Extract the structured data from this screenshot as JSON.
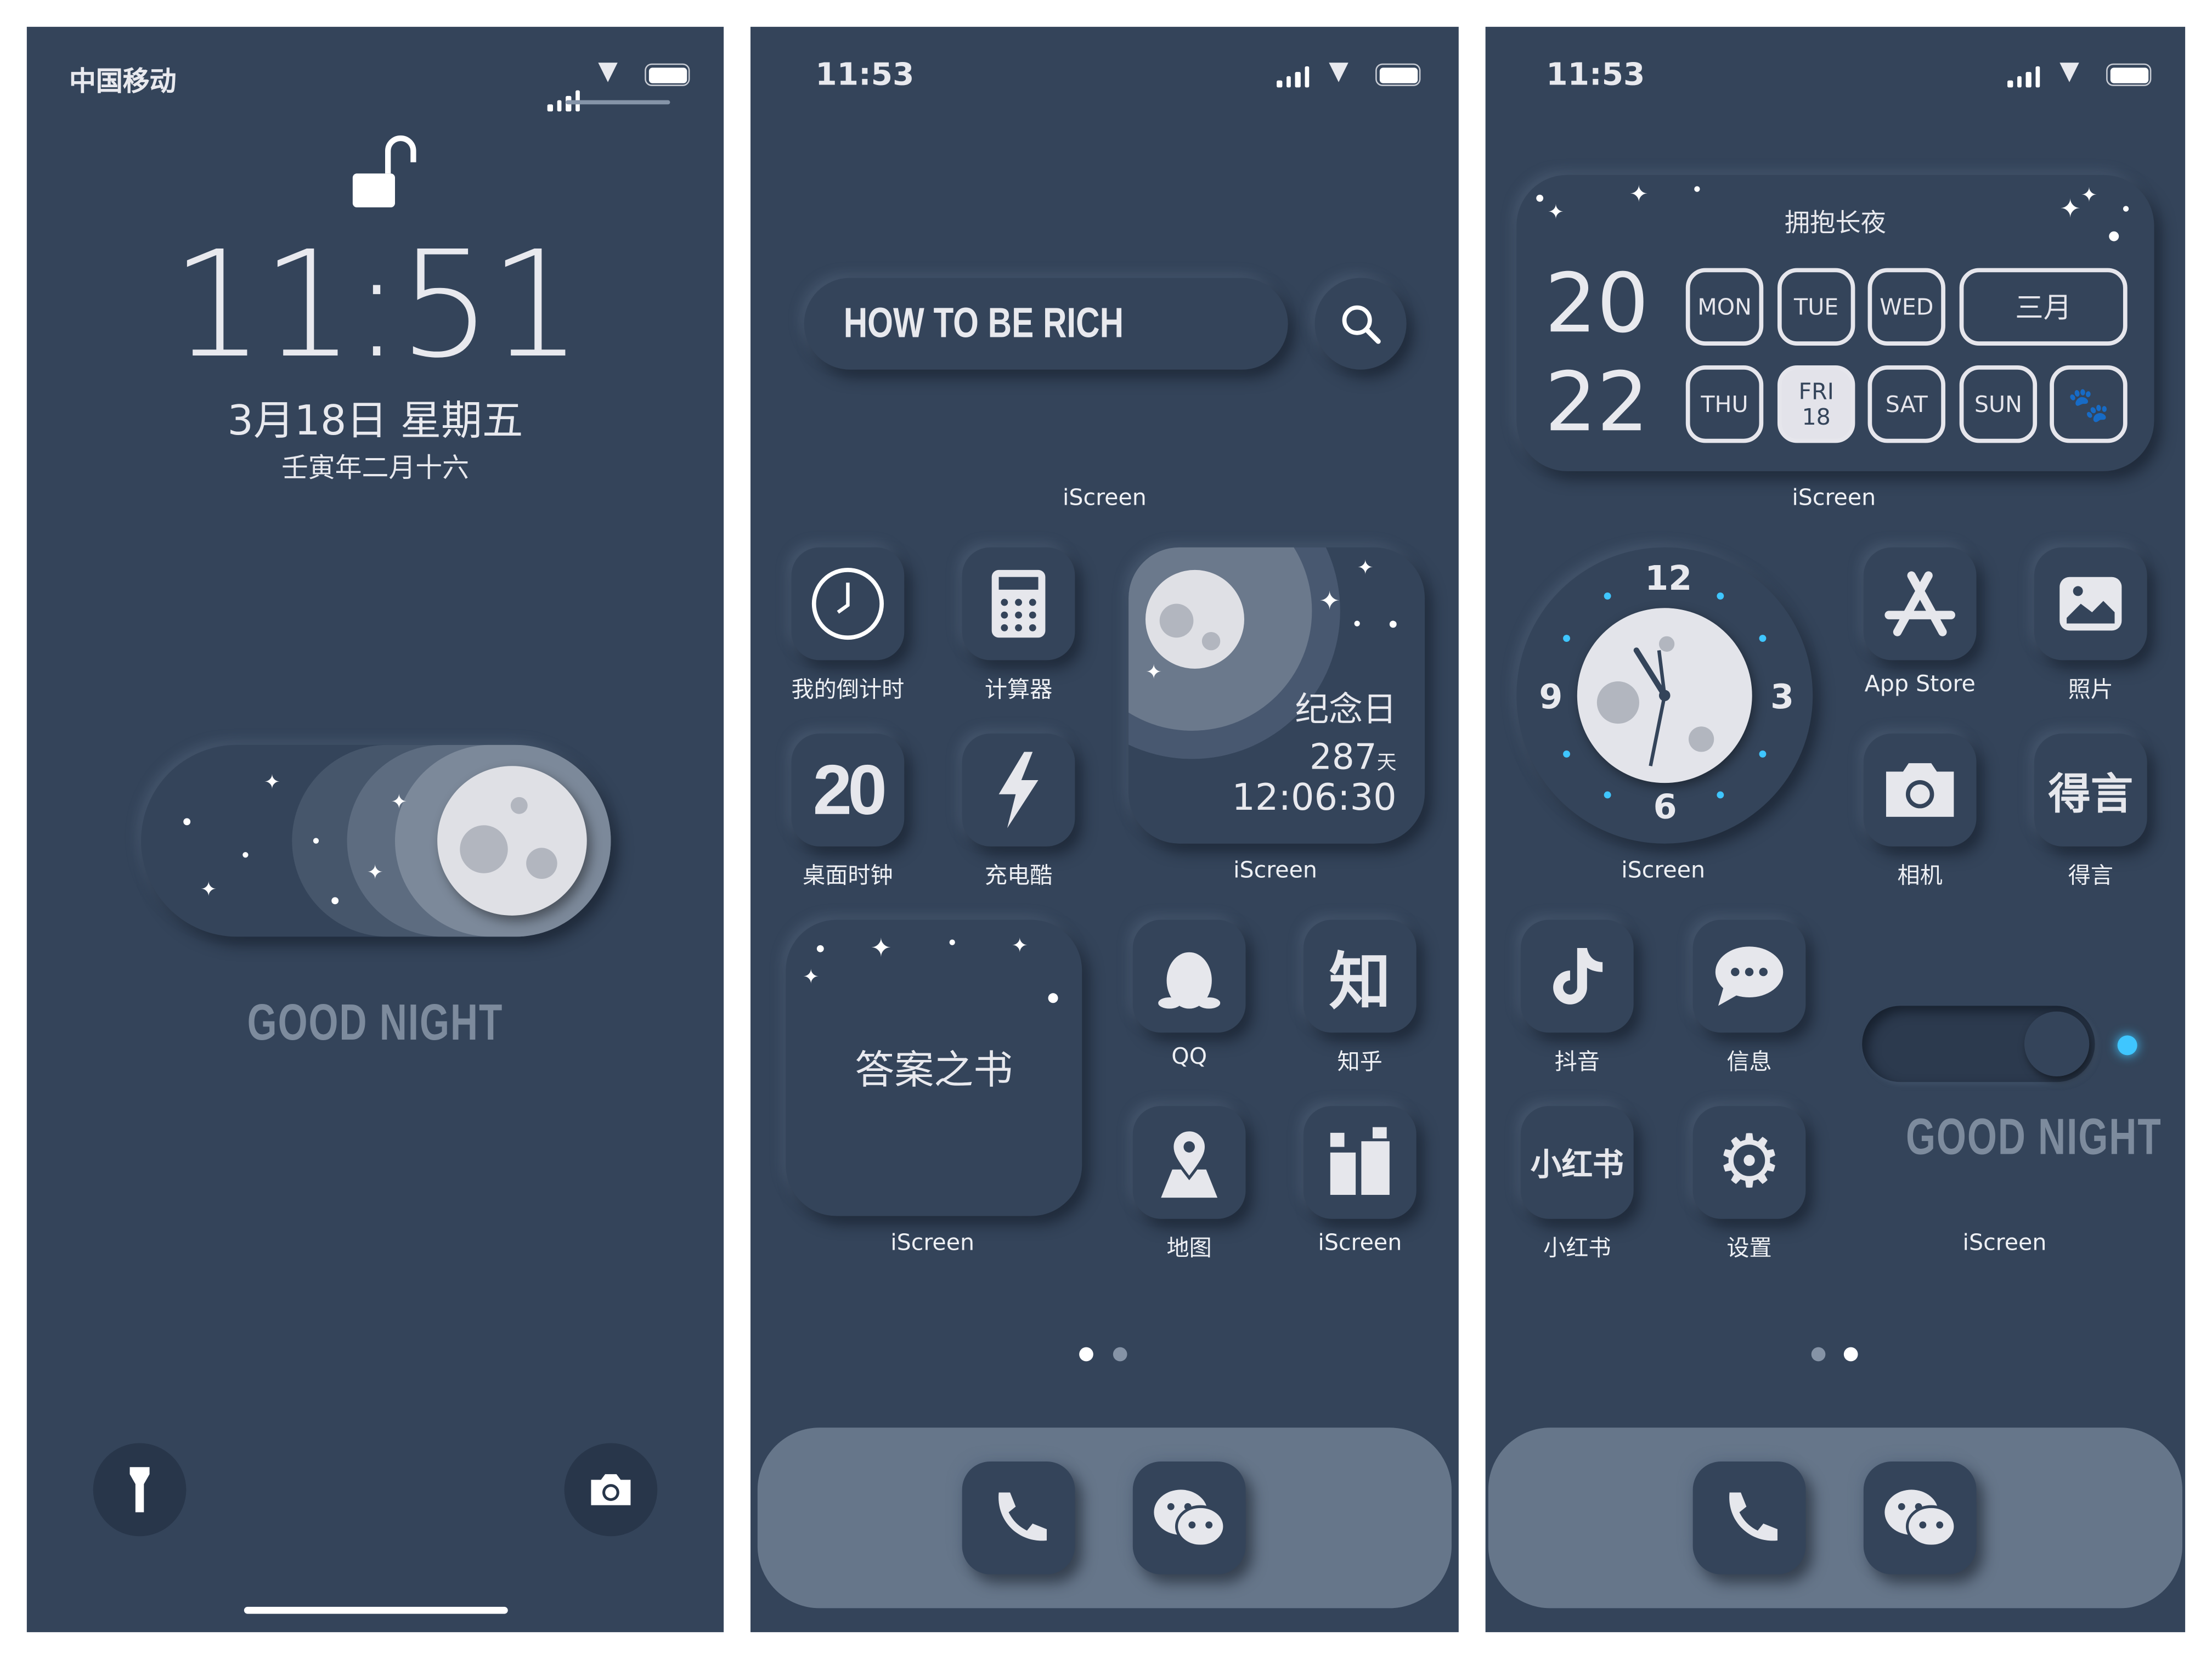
{
  "colors": {
    "background": "#34445a",
    "dock": "#66768a",
    "text": "#e8e9ee",
    "accent_blue": "#3fc6ff",
    "muted": "#7d8b9d"
  },
  "lock_screen": {
    "carrier": "中国移动",
    "time": "11:51",
    "date": "3月18日 星期五",
    "lunar": "壬寅年二月十六",
    "good_night": "GOOD NIGHT",
    "icons": [
      "signal-icon",
      "wifi-icon",
      "battery-icon",
      "unlock-icon",
      "flashlight-icon",
      "camera-icon"
    ]
  },
  "home1": {
    "time": "11:53",
    "search_text": "HOW TO BE RICH",
    "search_widget_label": "iScreen",
    "apps": [
      {
        "label": "我的倒计时",
        "icon": "clock-icon"
      },
      {
        "label": "计算器",
        "icon": "calculator-icon"
      },
      {
        "label": "桌面时钟",
        "icon": "20"
      },
      {
        "label": "充电酷",
        "icon": "lightning-icon"
      },
      {
        "label": "QQ",
        "icon": "penguin-icon"
      },
      {
        "label": "知乎",
        "icon": "知"
      },
      {
        "label": "地图",
        "icon": "map-pin-icon"
      },
      {
        "label": "iScreen",
        "icon": "blocks-icon"
      }
    ],
    "anniversary": {
      "title": "纪念日",
      "days": "287",
      "days_unit": "天",
      "time": "12:06:30",
      "label": "iScreen"
    },
    "book": {
      "title": "答案之书",
      "label": "iScreen"
    },
    "page_dots": {
      "count": 2,
      "active": 0
    },
    "dock": [
      {
        "icon": "phone-icon"
      },
      {
        "icon": "wechat-icon"
      }
    ]
  },
  "home2": {
    "time": "11:53",
    "calendar": {
      "title": "拥抱长夜",
      "year_top": "20",
      "year_bottom": "22",
      "days": [
        "MON",
        "TUE",
        "WED",
        "THU",
        "FRI",
        "SAT",
        "SUN"
      ],
      "month": "三月",
      "today_day": "FRI",
      "today_date": "18",
      "label": "iScreen"
    },
    "clock": {
      "numbers": [
        "12",
        "3",
        "6",
        "9"
      ],
      "label": "iScreen"
    },
    "apps": [
      {
        "label": "App Store",
        "icon": "app-store-icon"
      },
      {
        "label": "照片",
        "icon": "photos-icon"
      },
      {
        "label": "相机",
        "icon": "camera-icon"
      },
      {
        "label": "得言",
        "icon": "得言"
      },
      {
        "label": "抖音",
        "icon": "tiktok-icon"
      },
      {
        "label": "信息",
        "icon": "message-icon"
      },
      {
        "label": "小红书",
        "icon": "小红书"
      },
      {
        "label": "设置",
        "icon": "gear-icon"
      }
    ],
    "toggle": {
      "good_night": "GOOD NIGHT",
      "label": "iScreen"
    },
    "page_dots": {
      "count": 2,
      "active": 1
    },
    "dock": [
      {
        "icon": "phone-icon"
      },
      {
        "icon": "wechat-icon"
      }
    ]
  }
}
